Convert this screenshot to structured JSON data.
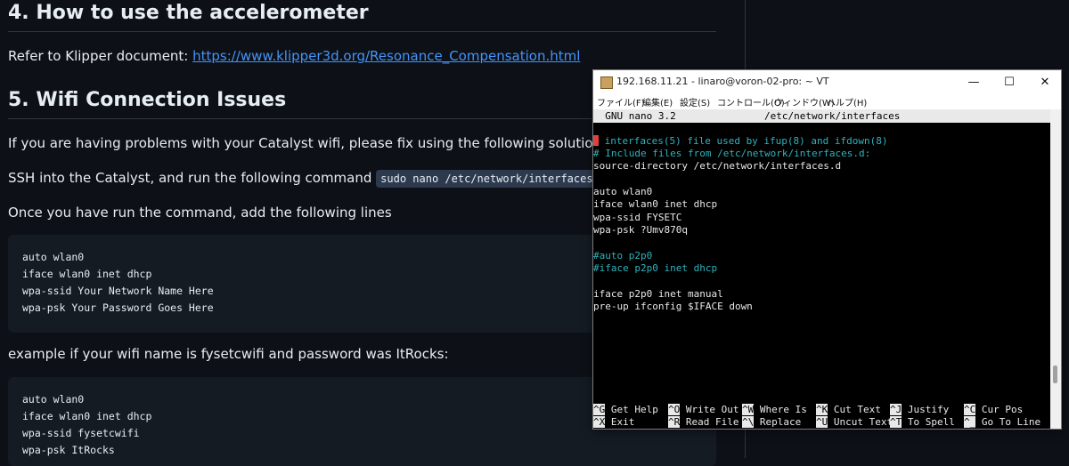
{
  "doc": {
    "section4_title": "4. How to use the accelerometer",
    "section4_text": "Refer to Klipper document: ",
    "section4_link": "https://www.klipper3d.org/Resonance_Compensation.html",
    "section5_title": "5. Wifi Connection Issues",
    "p1": "If you are having problems with your Catalyst wifi, please fix using the following solution.",
    "p2": "SSH into the Catalyst, and run the following command ",
    "p2_code": "sudo nano /etc/network/interfaces",
    "p3": "Once you have run the command, add the following lines",
    "code1": [
      "auto wlan0",
      "iface wlan0 inet dhcp",
      "wpa-ssid Your Network Name Here",
      "wpa-psk Your Password Goes Here"
    ],
    "p4": "example if your wifi name is fysetcwifi and password was ItRocks:",
    "code2": [
      "auto wlan0",
      "iface wlan0 inet dhcp",
      "wpa-ssid fysetcwifi",
      "wpa-psk ItRocks"
    ]
  },
  "terminal": {
    "title": "192.168.11.21 - linaro@voron-02-pro: ~ VT",
    "controls": {
      "minimize": "—",
      "maximize": "☐",
      "close": "✕"
    },
    "menu": [
      "ファイル(F)",
      "編集(E)",
      "設定(S)",
      "コントロール(O)",
      "ウィンドウ(W)",
      "ヘルプ(H)"
    ],
    "nano_version": "  GNU nano 3.2",
    "nano_file": "/etc/network/interfaces",
    "lines": [
      {
        "text": " interfaces(5) file used by ifup(8) and ifdown(8)",
        "color": "cyan"
      },
      {
        "text": "# Include files from /etc/network/interfaces.d:",
        "color": "cyan"
      },
      {
        "text": "source-directory /etc/network/interfaces.d",
        "color": "white"
      },
      {
        "text": "",
        "color": "white"
      },
      {
        "text": "auto wlan0",
        "color": "white"
      },
      {
        "text": "iface wlan0 inet dhcp",
        "color": "white"
      },
      {
        "text": "wpa-ssid FYSETC",
        "color": "white"
      },
      {
        "text": "wpa-psk ?Umv870q",
        "color": "white"
      },
      {
        "text": "",
        "color": "white"
      },
      {
        "text": "#auto p2p0",
        "color": "cyan"
      },
      {
        "text": "#iface p2p0 inet dhcp",
        "color": "cyan"
      },
      {
        "text": "",
        "color": "white"
      },
      {
        "text": "iface p2p0 inet manual",
        "color": "white"
      },
      {
        "text": "pre-up ifconfig $IFACE down",
        "color": "white"
      }
    ],
    "shortcuts_row1": [
      {
        "key": "^G",
        "label": " Get Help"
      },
      {
        "key": "^O",
        "label": " Write Out"
      },
      {
        "key": "^W",
        "label": " Where Is"
      },
      {
        "key": "^K",
        "label": " Cut Text"
      },
      {
        "key": "^J",
        "label": " Justify"
      },
      {
        "key": "^C",
        "label": " Cur Pos"
      }
    ],
    "shortcuts_row2": [
      {
        "key": "^X",
        "label": " Exit"
      },
      {
        "key": "^R",
        "label": " Read File"
      },
      {
        "key": "^\\",
        "label": " Replace"
      },
      {
        "key": "^U",
        "label": " Uncut Text"
      },
      {
        "key": "^T",
        "label": " To Spell"
      },
      {
        "key": "^_",
        "label": " Go To Line"
      }
    ]
  }
}
